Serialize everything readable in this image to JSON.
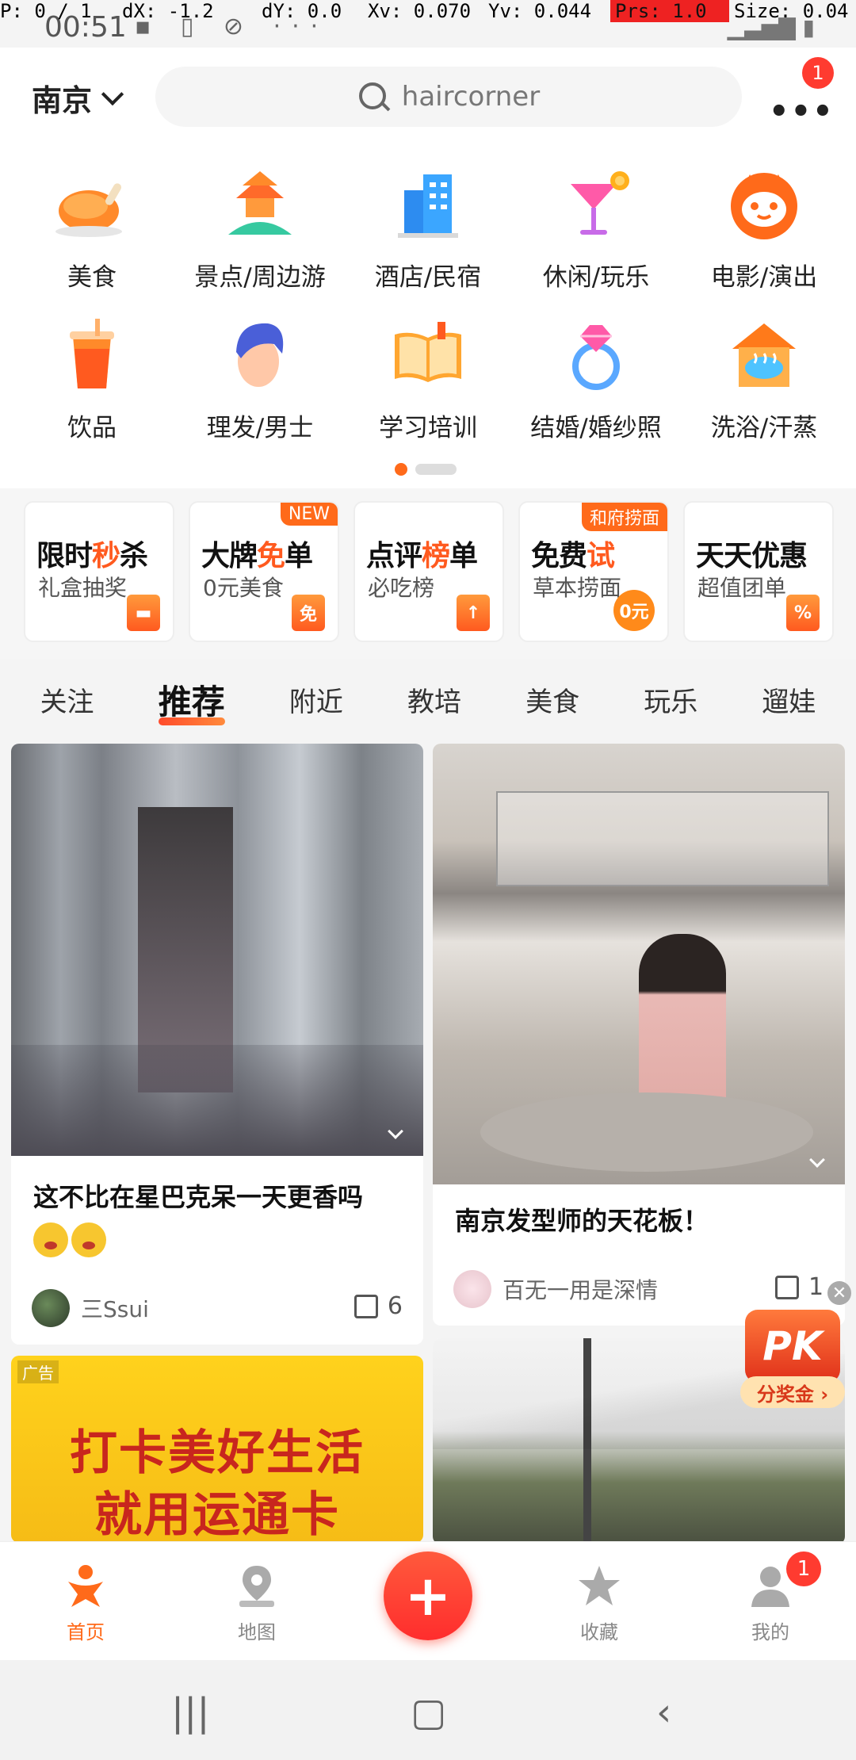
{
  "debug": {
    "p": "P: 0 / 1",
    "dx": "dX: -1.2",
    "dy": "dY: 0.0",
    "xv": "Xv: 0.070",
    "yv": "Yv: 0.044",
    "prs": "Prs: 1.0",
    "size": "Size: 0.04"
  },
  "status": {
    "time": "00:51"
  },
  "header": {
    "city": "南京",
    "search_value": "haircorner",
    "more_badge": "1"
  },
  "categories": [
    {
      "label": "美食",
      "icon": "roast-chicken-icon"
    },
    {
      "label": "景点/周边游",
      "icon": "pavilion-icon"
    },
    {
      "label": "酒店/民宿",
      "icon": "hotel-building-icon"
    },
    {
      "label": "休闲/玩乐",
      "icon": "cocktail-icon"
    },
    {
      "label": "电影/演出",
      "icon": "cat-face-icon"
    },
    {
      "label": "饮品",
      "icon": "drink-cup-icon"
    },
    {
      "label": "理发/男士",
      "icon": "man-hair-icon"
    },
    {
      "label": "学习培训",
      "icon": "open-book-icon"
    },
    {
      "label": "结婚/婚纱照",
      "icon": "diamond-ring-icon"
    },
    {
      "label": "洗浴/汗蒸",
      "icon": "bath-house-icon"
    }
  ],
  "promos": [
    {
      "title_a": "限时",
      "title_b": "秒",
      "title_c": "杀",
      "sub": "礼盒抽奖",
      "tag": "",
      "pic": ""
    },
    {
      "title_a": "大牌",
      "title_b": "免",
      "title_c": "单",
      "sub": "0元美食",
      "tag": "NEW",
      "pic": "免"
    },
    {
      "title_a": "点评",
      "title_b": "榜",
      "title_c": "单",
      "sub": "必吃榜",
      "tag": "",
      "pic": "↑"
    },
    {
      "title_a": "免费",
      "title_b": "试",
      "title_c": "",
      "sub": "草本捞面",
      "tag": "和府捞面",
      "pic": "0元"
    },
    {
      "title_a": "天天",
      "title_b": "优",
      "title_c": "惠",
      "sub": "超值团单",
      "tag": "",
      "pic": "%"
    }
  ],
  "tabs": [
    "关注",
    "推荐",
    "附近",
    "教培",
    "美食",
    "玩乐",
    "遛娃"
  ],
  "feed": {
    "card1": {
      "caption": "这不比在星巴克呆一天更香吗",
      "author": "三Ssui",
      "likes": "6"
    },
    "card2": {
      "caption": "南京发型师的天花板！",
      "author": "百无一用是深情",
      "likes": "1"
    },
    "ad": {
      "tag": "广告",
      "line1": "打卡美好生活",
      "line2": "就用运通卡"
    }
  },
  "pk": {
    "title": "PK",
    "label": "分奖金 ›"
  },
  "bottom_nav": {
    "home": "首页",
    "map": "地图",
    "add": "+",
    "fav": "收藏",
    "me": "我的",
    "me_badge": "1"
  },
  "colors": {
    "accent": "#ff6a1a",
    "badge": "#ff3b30"
  }
}
